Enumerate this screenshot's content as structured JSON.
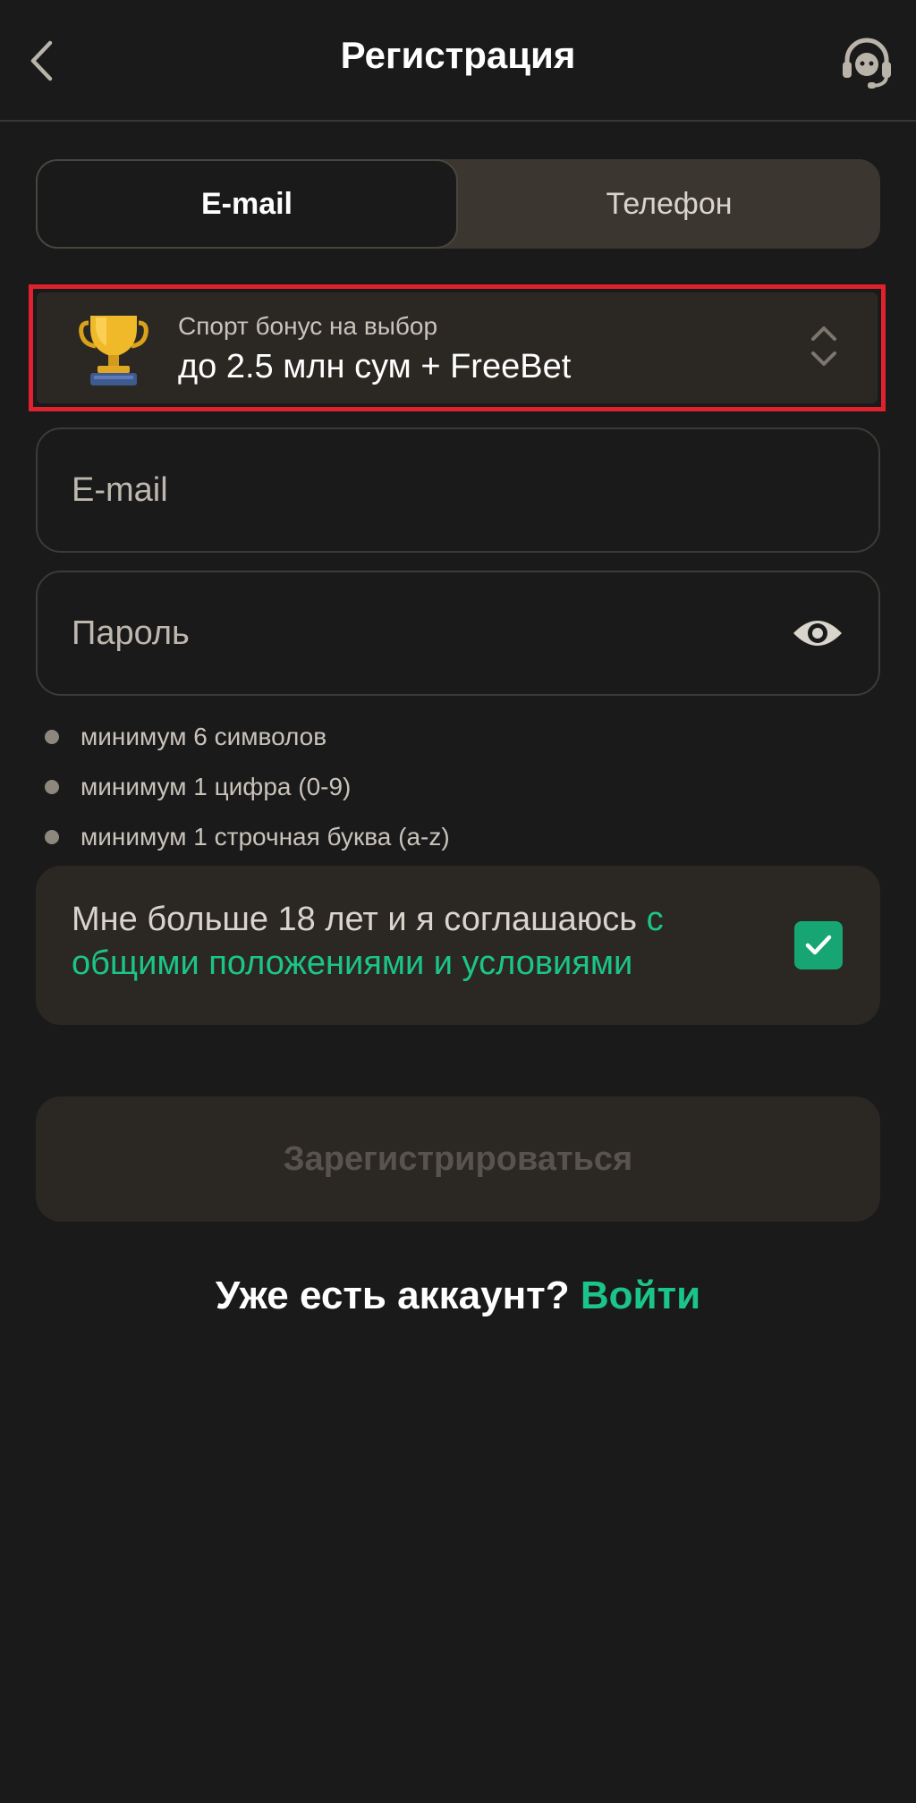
{
  "header": {
    "title": "Регистрация",
    "back_icon": "chevron-left-icon",
    "support_icon": "headset-icon"
  },
  "tabs": [
    {
      "label": "E-mail",
      "active": true
    },
    {
      "label": "Телефон",
      "active": false
    }
  ],
  "bonus": {
    "caption": "Спорт бонус на выбор",
    "value": "до 2.5 млн сум + FreeBet",
    "icon": "trophy-icon",
    "selector_icon": "chevron-up-down-icon",
    "highlight_color": "#e0212e"
  },
  "form": {
    "email_placeholder": "E-mail",
    "email_value": "",
    "password_placeholder": "Пароль",
    "password_value": "",
    "password_toggle_icon": "eye-icon"
  },
  "password_rules": [
    "минимум 6 символов",
    "минимум 1 цифра (0-9)",
    "минимум 1 строчная буква (a-z)"
  ],
  "consent": {
    "text": "Мне больше 18 лет и я соглашаюсь ",
    "link_text": "с общими положениями и условиями",
    "checked": true
  },
  "register_button": {
    "label": "Зарегистрироваться",
    "enabled": false
  },
  "login_prompt": {
    "text": "Уже есть аккаунт? ",
    "link": "Войти"
  },
  "colors": {
    "background": "#1a1a1a",
    "surface": "#2b2824",
    "accent_green": "#1bc58a",
    "checkbox_green": "#17a673"
  }
}
